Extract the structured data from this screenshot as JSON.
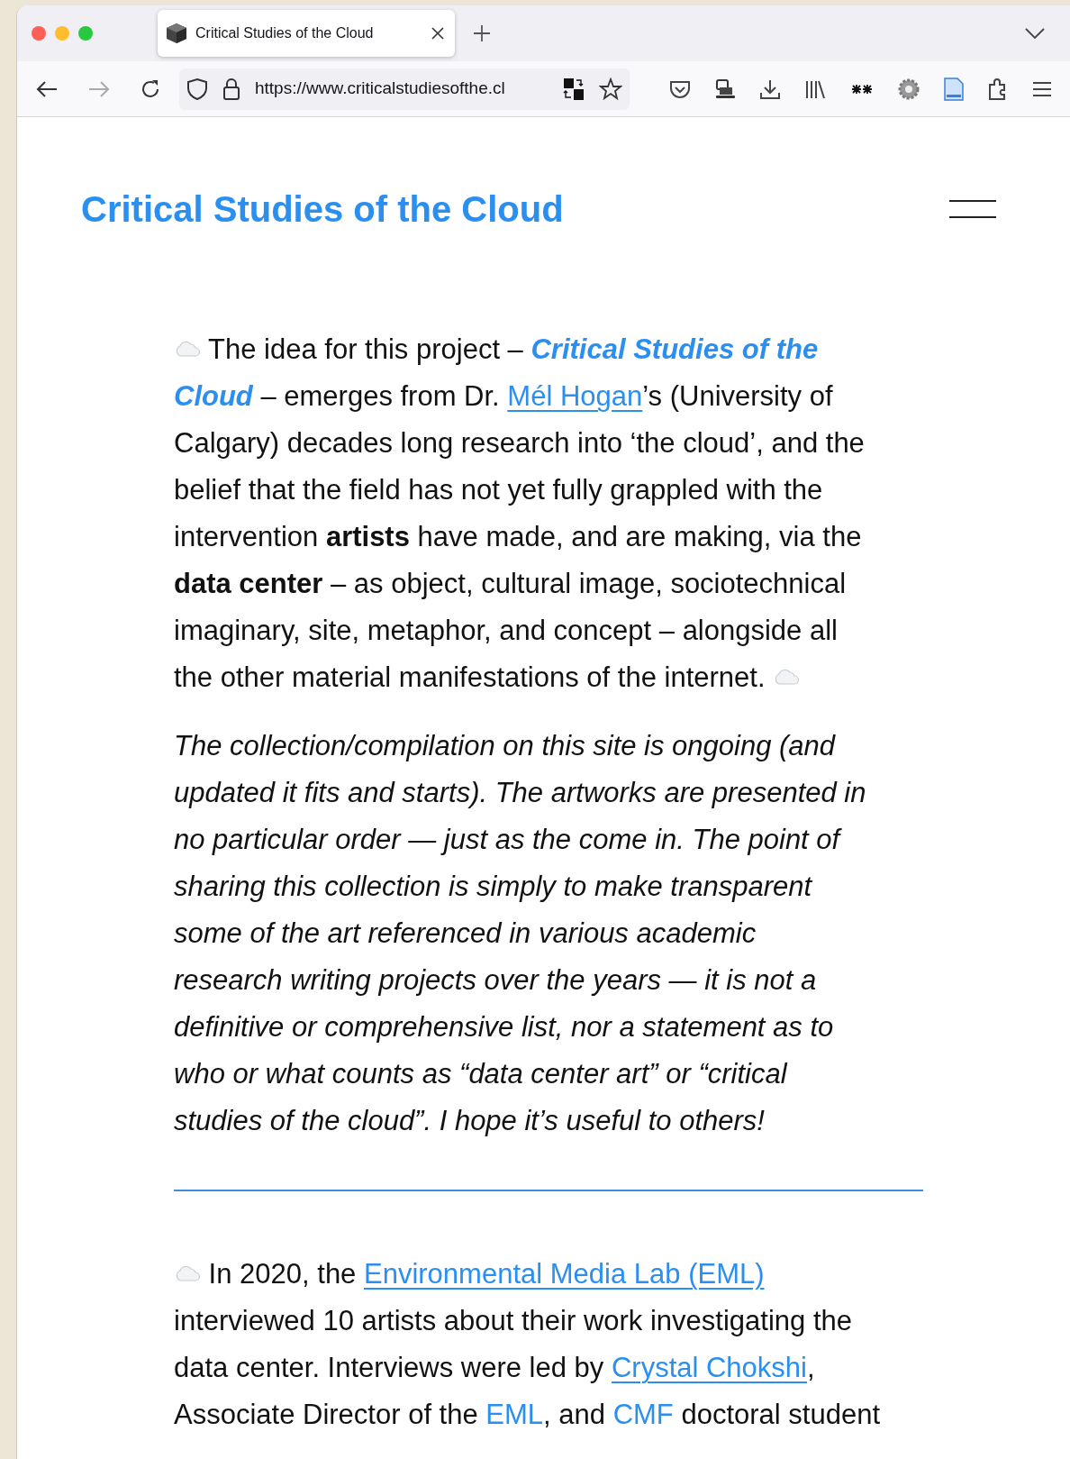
{
  "browser": {
    "tab": {
      "title": "Critical Studies of the Cloud"
    },
    "url": "https://www.criticalstudiesofthe.cl"
  },
  "site": {
    "title": "Critical Studies of the Cloud"
  },
  "paragraphs": [
    {
      "kind": "plain",
      "segments": [
        {
          "kind": "icon"
        },
        {
          "kind": "text",
          "text": " The idea for this project – "
        },
        {
          "kind": "emph-link",
          "text": "Critical Studies of the"
        },
        {
          "kind": "break"
        },
        {
          "kind": "emph-link",
          "text": "Cloud"
        },
        {
          "kind": "text",
          "text": " – emerges from Dr. "
        },
        {
          "kind": "link",
          "text": "Mél Hogan"
        },
        {
          "kind": "text",
          "text": "’s (University of\nCalgary) decades long research into ‘the cloud’, and the\nbelief that the field has not yet fully grappled with the\nintervention "
        },
        {
          "kind": "bold",
          "text": "artists"
        },
        {
          "kind": "text",
          "text": " have made, and are making, via the\n"
        },
        {
          "kind": "bold",
          "text": "data center"
        },
        {
          "kind": "text",
          "text": " – as object, cultural image, sociotechnical\nimaginary, site, metaphor, and concept – alongside all\nthe other material manifestations of the internet. "
        },
        {
          "kind": "icon"
        }
      ]
    },
    {
      "kind": "italic",
      "segments": [
        {
          "kind": "text",
          "text": "The collection/compilation on this site is ongoing (and\nupdated it fits and starts). The artworks are presented in\nno particular order — just as the come in. The point of\nsharing this collection is simply to make transparent\nsome of the art referenced in various academic\nresearch writing projects over the years — it is not a\ndefinitive or comprehensive list, nor a statement as to\nwho or what counts as “data center art” or “critical\nstudies of the cloud”. I hope it’s useful to others!"
        }
      ]
    },
    {
      "kind": "rule"
    },
    {
      "kind": "plain",
      "segments": [
        {
          "kind": "icon"
        },
        {
          "kind": "text",
          "text": " In 2020, the "
        },
        {
          "kind": "link",
          "text": "Environmental Media Lab (EML)"
        },
        {
          "kind": "text",
          "text": "\ninterviewed 10 artists about their work investigating the\ndata center. Interviews were led by "
        },
        {
          "kind": "link",
          "text": "Crystal Chokshi"
        },
        {
          "kind": "text",
          "text": ",\nAssociate Director of the "
        },
        {
          "kind": "plain-link",
          "text": "EML"
        },
        {
          "kind": "text",
          "text": ", and "
        },
        {
          "kind": "plain-link",
          "text": "CMF"
        },
        {
          "kind": "text",
          "text": " doctoral student"
        }
      ]
    }
  ]
}
